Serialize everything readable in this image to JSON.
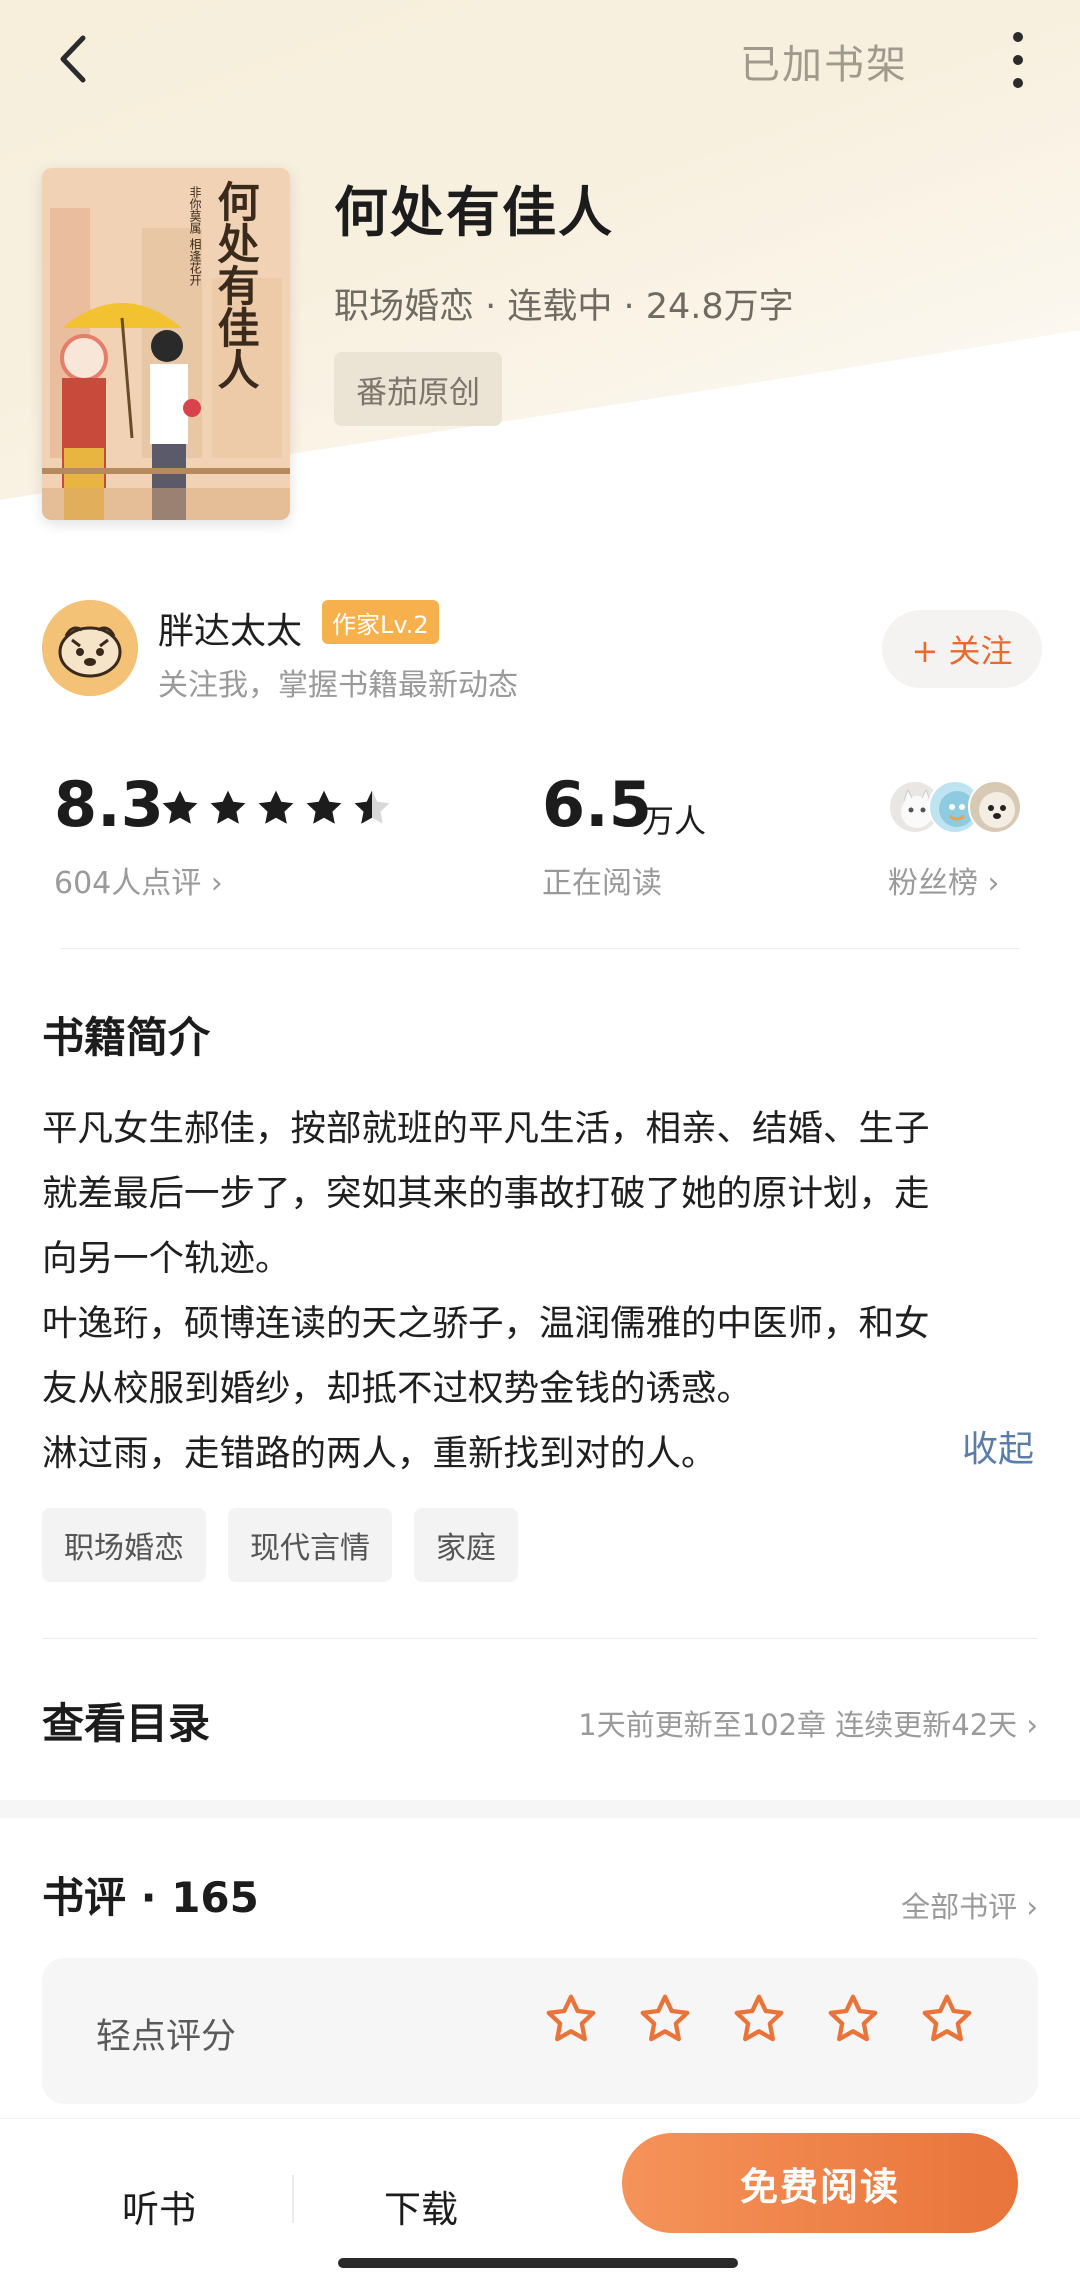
{
  "header": {
    "shelf_label": "已加书架",
    "back_icon": "chevron-left-icon",
    "more_icon": "more-vertical-icon"
  },
  "book": {
    "title": "何处有佳人",
    "meta": "职场婚恋 · 连载中 · 24.8万字",
    "origin_tag": "番茄原创",
    "cover_title": "何处有佳人",
    "cover_subtitle": "非你莫属 相逢花开"
  },
  "author": {
    "name": "胖达太太",
    "level": "作家Lv.2",
    "subtitle": "关注我，掌握书籍最新动态",
    "follow_label": "+ 关注"
  },
  "stats": {
    "score": "8.3",
    "stars_filled": 4.5,
    "rating_count": "604人点评 ›",
    "readers": "6.5",
    "readers_unit": "万人",
    "readers_label": "正在阅读",
    "fans_label": "粉丝榜 ›"
  },
  "intro": {
    "title": "书籍简介",
    "lines": [
      "平凡女生郝佳，按部就班的平凡生活，相亲、结婚、生子",
      "就差最后一步了，突如其来的事故打破了她的原计划，走",
      "向另一个轨迹。",
      "叶逸珩，硕博连读的天之骄子，温润儒雅的中医师，和女",
      "友从校服到婚纱，却抵不过权势金钱的诱惑。",
      "淋过雨，走错路的两人，重新找到对的人。"
    ],
    "collapse_label": "收起"
  },
  "tags": [
    "职场婚恋",
    "现代言情",
    "家庭"
  ],
  "toc": {
    "title": "查看目录",
    "info": "1天前更新至102章 连续更新42天 ›"
  },
  "reviews": {
    "title": "书评 · 165",
    "all_label": "全部书评 ›",
    "rate_label": "轻点评分",
    "rate_star_count": 5
  },
  "bottom": {
    "listen": "听书",
    "download": "下载",
    "read": "免费阅读"
  },
  "colors": {
    "accent": "#e8743a",
    "link": "#5b7ea8",
    "level_badge": "#f7b14c"
  }
}
